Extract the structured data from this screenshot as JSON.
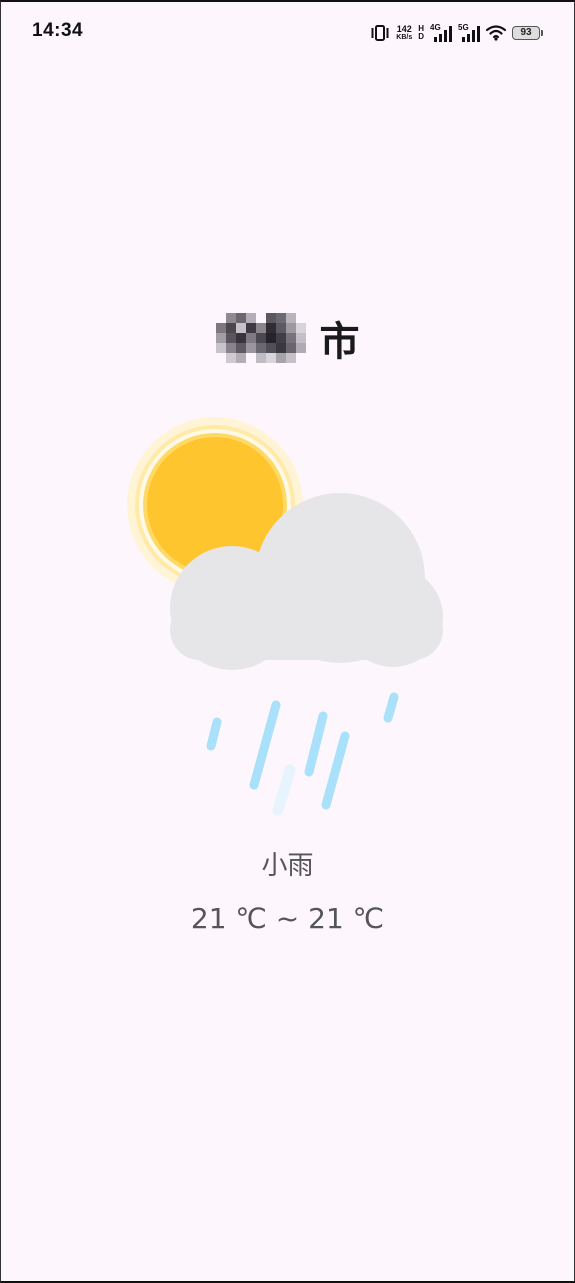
{
  "status_bar": {
    "time": "14:34",
    "speed_value": "142",
    "speed_unit": "KB/s",
    "hd_top": "H",
    "hd_bottom": "D",
    "network_1": "4G",
    "network_2": "5G",
    "battery": "93",
    "icons": [
      "vibrate-icon",
      "signal-icon",
      "signal-icon",
      "wifi-icon",
      "battery-icon"
    ]
  },
  "location": {
    "city_suffix": "市",
    "city_name_redacted": true
  },
  "weather": {
    "icon": "sun-cloud-rain-icon",
    "condition": "小雨",
    "temp_range": "21 ℃ ~ 21 ℃"
  },
  "colors": {
    "background": "#fdf7fd",
    "sun": "#ffc52e",
    "sun_glow": "#fff0c4",
    "cloud": "#e6e6e8",
    "rain": "#a9e1fa",
    "text": "#555555"
  }
}
